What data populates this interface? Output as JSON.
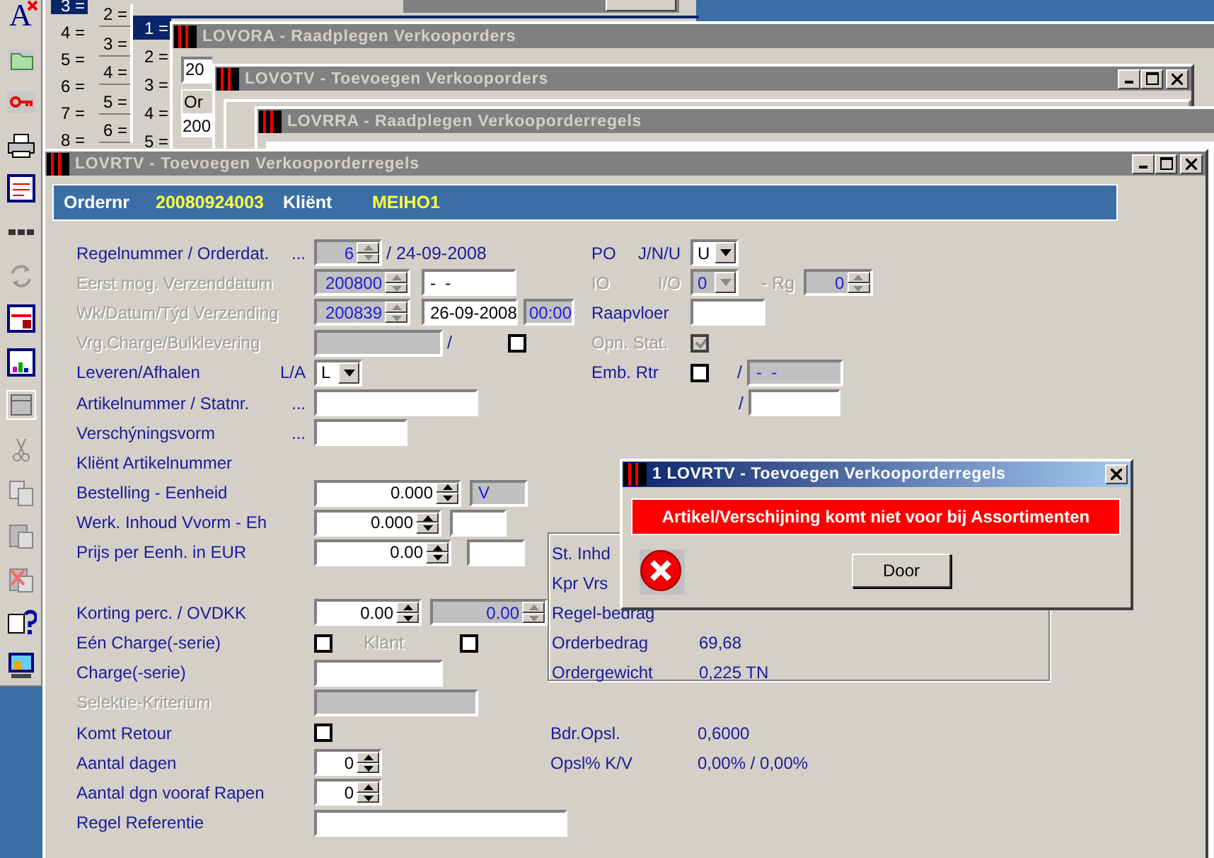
{
  "toolbar": {
    "format_glyph": "A"
  },
  "background_lists": [
    {
      "items": [
        {
          "label": "3 =",
          "selected": true
        },
        {
          "label": "4 =",
          "selected": false
        },
        {
          "label": "5 =",
          "selected": false
        },
        {
          "label": "6 =",
          "selected": false
        },
        {
          "label": "7 =",
          "selected": false
        },
        {
          "label": "8 =",
          "selected": false
        }
      ]
    },
    {
      "items": [
        {
          "label": "2 =",
          "selected": false
        },
        {
          "label": "3 =",
          "selected": false
        },
        {
          "label": "4 =",
          "selected": false
        },
        {
          "label": "5 =",
          "selected": false
        },
        {
          "label": "6 =",
          "selected": false
        }
      ]
    },
    {
      "items": [
        {
          "label": "1 =",
          "selected": true
        },
        {
          "label": "2 =",
          "selected": false
        },
        {
          "label": "3 =",
          "selected": false
        },
        {
          "label": "4 =",
          "selected": false
        },
        {
          "label": "5 =",
          "selected": false
        }
      ]
    }
  ],
  "background_windows": [
    {
      "title": "LOVORA - Raadplegen Verkooporders",
      "field": "20",
      "column": "Or",
      "cell": "200"
    },
    {
      "title": "LOVOTV - Toevoegen Verkooporders"
    },
    {
      "title": "LOVRRA - Raadplegen Verkooporderregels"
    }
  ],
  "window": {
    "title": "LOVRTV - Toevoegen Verkooporderregels"
  },
  "header": {
    "ordernr_label": "Ordernr",
    "ordernr": "20080924003",
    "client_label": "Kliënt",
    "client": "MEIHO1"
  },
  "left_sections": [
    {
      "rows": [
        {
          "label": "Regelnummer / Orderdat.",
          "suffix": "...",
          "disabled": false,
          "controls": [
            {
              "kind": "spin",
              "value": "6",
              "disabled": true
            },
            {
              "kind": "text",
              "value": "/ 24-09-2008",
              "disabled": false
            }
          ]
        },
        {
          "label": "Eerst mog. Verzenddatum",
          "disabled": true,
          "controls": [
            {
              "kind": "spin",
              "value": "200800",
              "disabled": true
            },
            {
              "kind": "field",
              "value": "-  -",
              "disabled": false
            }
          ]
        },
        {
          "label": "Wk/Datum/Týd Verzending",
          "disabled": true,
          "controls": [
            {
              "kind": "spin",
              "value": "200839",
              "disabled": true
            },
            {
              "kind": "field",
              "value": "26-09-2008",
              "disabled": false
            },
            {
              "kind": "field",
              "value": "00:00",
              "disabled": true
            }
          ]
        },
        {
          "label": "Vrg.Charge/Bulklevering",
          "disabled": true,
          "controls": [
            {
              "kind": "field",
              "disabled": true
            },
            {
              "kind": "text",
              "value": "/",
              "disabled": false
            },
            {
              "kind": "check",
              "checked": false,
              "disabled": false
            }
          ]
        },
        {
          "label": "Leveren/Afhalen",
          "suffix": "L/A",
          "disabled": false,
          "controls": [
            {
              "kind": "combo",
              "value": "L",
              "disabled": false
            }
          ]
        },
        {
          "label": "Artikelnummer / Statnr.",
          "suffix": "...",
          "disabled": false,
          "controls": [
            {
              "kind": "field",
              "disabled": false
            }
          ]
        },
        {
          "label": "Verschýningsvorm",
          "suffix": "...",
          "disabled": false,
          "controls": [
            {
              "kind": "field",
              "disabled": false
            }
          ]
        },
        {
          "label": "Kliënt Artikelnummer",
          "disabled": false,
          "controls": []
        },
        {
          "label": "Bestelling - Eenheid",
          "disabled": false,
          "controls": [
            {
              "kind": "spin",
              "value": "0.000",
              "disabled": false
            },
            {
              "kind": "field",
              "value": "V",
              "disabled": true
            }
          ]
        },
        {
          "label": "Werk. Inhoud Vvorm - Eh",
          "disabled": false,
          "controls": [
            {
              "kind": "spin",
              "value": "0.000",
              "disabled": false
            },
            {
              "kind": "field",
              "disabled": false
            }
          ]
        },
        {
          "label": "Prijs per Eenh. in EUR",
          "disabled": false,
          "controls": [
            {
              "kind": "spin",
              "value": "0.00",
              "disabled": false
            },
            {
              "kind": "field",
              "disabled": false
            }
          ]
        }
      ]
    },
    {
      "rows": [
        {
          "label": "Korting perc. / OVDKK",
          "disabled": false,
          "controls": [
            {
              "kind": "spin",
              "value": "0.00",
              "disabled": false
            },
            {
              "kind": "spin",
              "value": "0.00",
              "disabled": true
            }
          ]
        },
        {
          "label": "Eén Charge(-serie)",
          "disabled": false,
          "controls": [
            {
              "kind": "check",
              "checked": false,
              "disabled": false
            },
            {
              "kind": "text",
              "value": "Klant",
              "disabled": true
            },
            {
              "kind": "check",
              "checked": false,
              "disabled": false
            }
          ]
        },
        {
          "label": "Charge(-serie)",
          "disabled": false,
          "controls": [
            {
              "kind": "field",
              "disabled": false
            }
          ]
        },
        {
          "label": "Selektie-Kriterium",
          "disabled": true,
          "controls": [
            {
              "kind": "field",
              "disabled": true
            }
          ]
        },
        {
          "label": "Komt Retour",
          "disabled": false,
          "controls": [
            {
              "kind": "check",
              "checked": false,
              "disabled": false
            }
          ]
        },
        {
          "label": "Aantal dagen",
          "disabled": false,
          "controls": [
            {
              "kind": "spin",
              "value": "0",
              "disabled": false
            }
          ]
        },
        {
          "label": "Aantal dgn vooraf Rapen",
          "disabled": false,
          "controls": [
            {
              "kind": "spin",
              "value": "0",
              "disabled": false
            }
          ]
        },
        {
          "label": "Regel Referentie",
          "disabled": false,
          "controls": [
            {
              "kind": "field",
              "disabled": false
            }
          ]
        }
      ]
    }
  ],
  "right_rows": [
    {
      "label": "PO",
      "label2": "J/N/U",
      "disabled": false,
      "controls": [
        {
          "kind": "combo",
          "value": "U",
          "disabled": false
        }
      ]
    },
    {
      "label": "IO",
      "label2": "I/O",
      "disabled": true,
      "controls": [
        {
          "kind": "combo",
          "value": "0",
          "disabled": true
        },
        {
          "kind": "text",
          "value": "- Rg",
          "disabled": true
        },
        {
          "kind": "spin",
          "value": "0",
          "disabled": true
        }
      ]
    },
    {
      "label": "Raapvloer",
      "disabled": false,
      "controls": [
        {
          "kind": "field",
          "disabled": false
        }
      ]
    },
    {
      "label": "Opn. Stat.",
      "disabled": true,
      "controls": [
        {
          "kind": "check",
          "checked": true,
          "disabled": true
        }
      ]
    },
    {
      "label": "Emb. Rtr",
      "disabled": false,
      "controls": [
        {
          "kind": "check",
          "checked": false,
          "disabled": false
        },
        {
          "kind": "text",
          "value": "/",
          "disabled": false
        },
        {
          "kind": "field",
          "value": "-  -",
          "disabled": true
        }
      ]
    },
    {
      "controls": [
        {
          "kind": "text",
          "value": "/",
          "disabled": false
        },
        {
          "kind": "field",
          "disabled": false
        }
      ]
    }
  ],
  "summary_box": {
    "rows": [
      {
        "label": "St. Inhd"
      },
      {
        "label": "Kpr Vrs"
      },
      {
        "label": "Regel-bedrag"
      },
      {
        "label": "Orderbedrag",
        "value": "69,68"
      },
      {
        "label": "Ordergewicht",
        "value": "0,225 TN"
      }
    ]
  },
  "totals": [
    {
      "label": "Bdr.Opsl.",
      "value": "0,6000"
    },
    {
      "label": "Opsl% K/V",
      "value": "0,00% / 0,00%"
    }
  ],
  "dialog": {
    "title": "1 LOVRTV - Toevoegen Verkooporderregels",
    "message": "Artikel/Verschijning komt niet voor bij Assortimenten",
    "button": "Door"
  }
}
